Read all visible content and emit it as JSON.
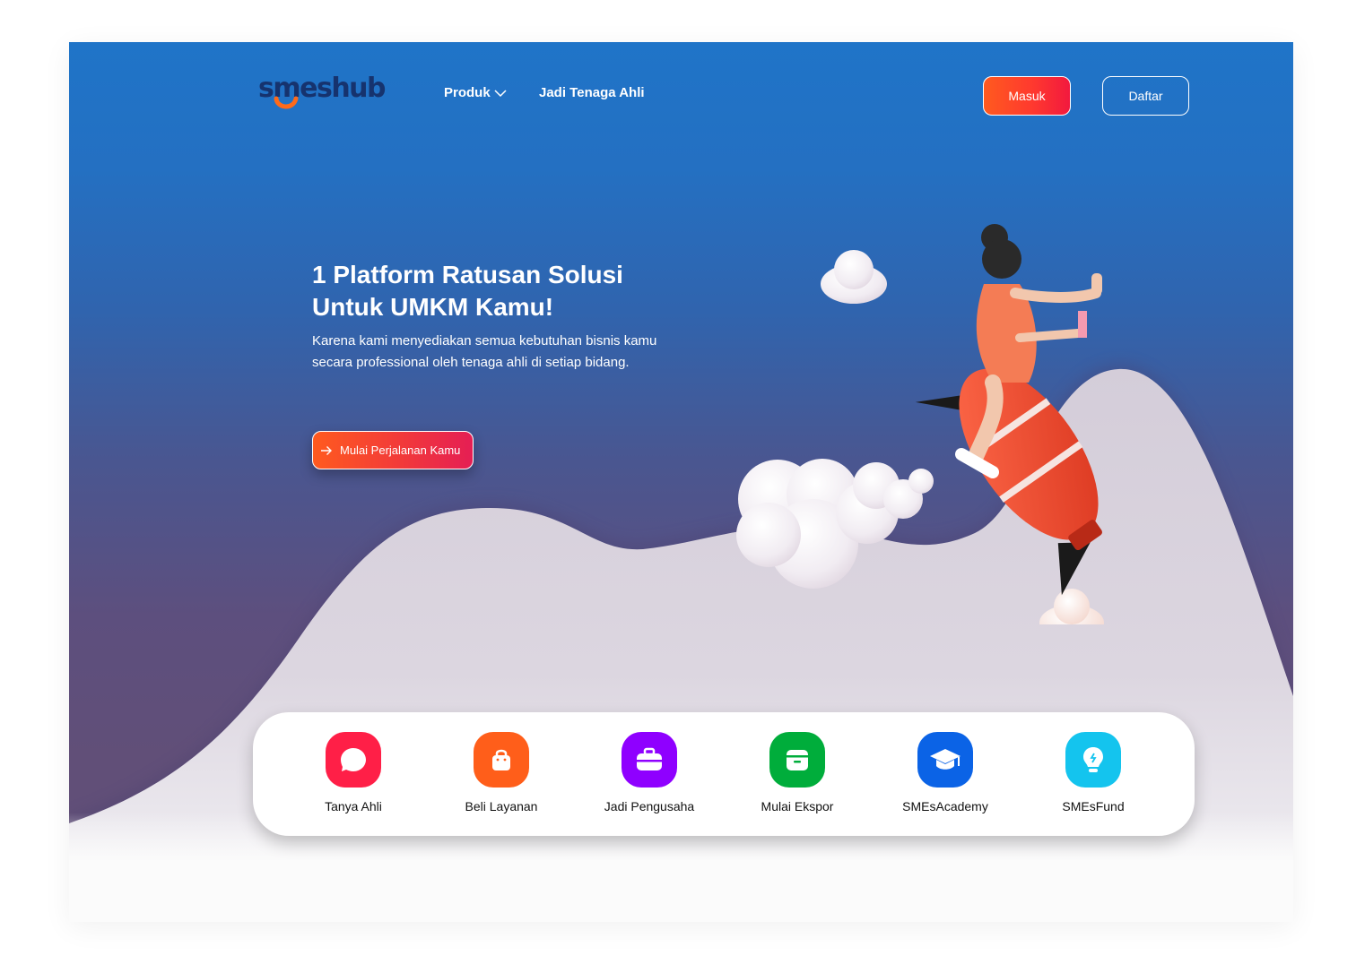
{
  "brand": {
    "logo_text": "smeshub"
  },
  "nav": {
    "produk_label": "Produk",
    "tenaga_ahli_label": "Jadi Tenaga Ahli",
    "masuk_label": "Masuk",
    "daftar_label": "Daftar"
  },
  "hero": {
    "title_line1": "1 Platform Ratusan Solusi",
    "title_line2": "Untuk UMKM Kamu!",
    "subtitle": "Karena kami menyediakan semua kebutuhan bisnis kamu secara professional oleh tenaga ahli di setiap bidang.",
    "cta_label": "Mulai Perjalanan Kamu"
  },
  "services": [
    {
      "label": "Tanya Ahli",
      "icon": "chat-bubble-icon",
      "color": "#ff1f47"
    },
    {
      "label": "Beli Layanan",
      "icon": "shopping-bag-icon",
      "color": "#ff5e1a"
    },
    {
      "label": "Jadi Pengusaha",
      "icon": "briefcase-icon",
      "color": "#8f00ff"
    },
    {
      "label": "Mulai Ekspor",
      "icon": "box-icon",
      "color": "#00ad3b"
    },
    {
      "label": "SMEsAcademy",
      "icon": "graduation-cap-icon",
      "color": "#0b63e6"
    },
    {
      "label": "SMEsFund",
      "icon": "lightbulb-icon",
      "color": "#14c4ee"
    }
  ],
  "colors": {
    "hero_top": "#1f74c8",
    "hero_bottom": "#614f78",
    "accent_orange": "#ff5a1f",
    "accent_red": "#f2193e",
    "logo_navy": "#16336e",
    "logo_orange": "#ff6a1a"
  }
}
